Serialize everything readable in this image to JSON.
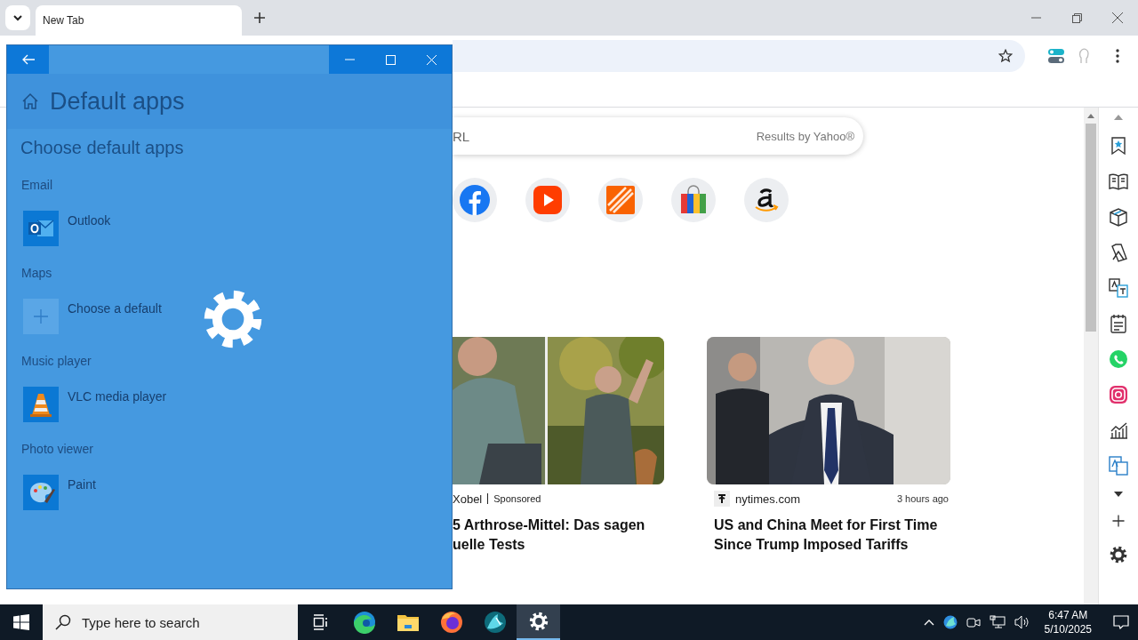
{
  "browser": {
    "tabs": [
      {
        "label": "New Tab",
        "selected": true
      }
    ]
  },
  "new_tab_page": {
    "search": {
      "placeholder": "RL",
      "provider": "Results by Yahoo®"
    },
    "shortcuts": [
      {
        "kind": "facebook"
      },
      {
        "kind": "video"
      },
      {
        "kind": "tile"
      },
      {
        "kind": "bag"
      },
      {
        "kind": "store"
      }
    ],
    "cards": [
      {
        "kind": "sponsored",
        "source": "Xobel",
        "badge": "Sponsored",
        "title_lines": [
          "5 Arthrose-Mittel: Das sagen",
          "uelle Tests"
        ]
      },
      {
        "kind": "news",
        "source": "nytimes.com",
        "time": "3 hours ago",
        "title_lines": [
          "US and China Meet for First Time",
          "Since Trump Imposed Tariffs"
        ]
      }
    ]
  },
  "settings_window": {
    "title": "Default apps",
    "heading": "Choose default apps",
    "loading": true,
    "categories": [
      {
        "label": "Email",
        "app": "Outlook",
        "kind": "outlook"
      },
      {
        "label": "Maps",
        "app": "Choose a default",
        "kind": "none"
      },
      {
        "label": "Music player",
        "app": "VLC media player",
        "kind": "vlc"
      },
      {
        "label": "Photo viewer",
        "app": "Paint",
        "kind": "paint"
      }
    ]
  },
  "taskbar": {
    "search_placeholder": "Type here to search",
    "apps": [
      {
        "kind": "task-view",
        "selected": false
      },
      {
        "kind": "edge",
        "selected": false
      },
      {
        "kind": "explorer",
        "selected": false
      },
      {
        "kind": "firefox",
        "selected": false
      },
      {
        "kind": "app",
        "selected": false
      },
      {
        "kind": "settings",
        "selected": true
      }
    ],
    "time": "6:47 AM",
    "date": "5/10/2025"
  }
}
